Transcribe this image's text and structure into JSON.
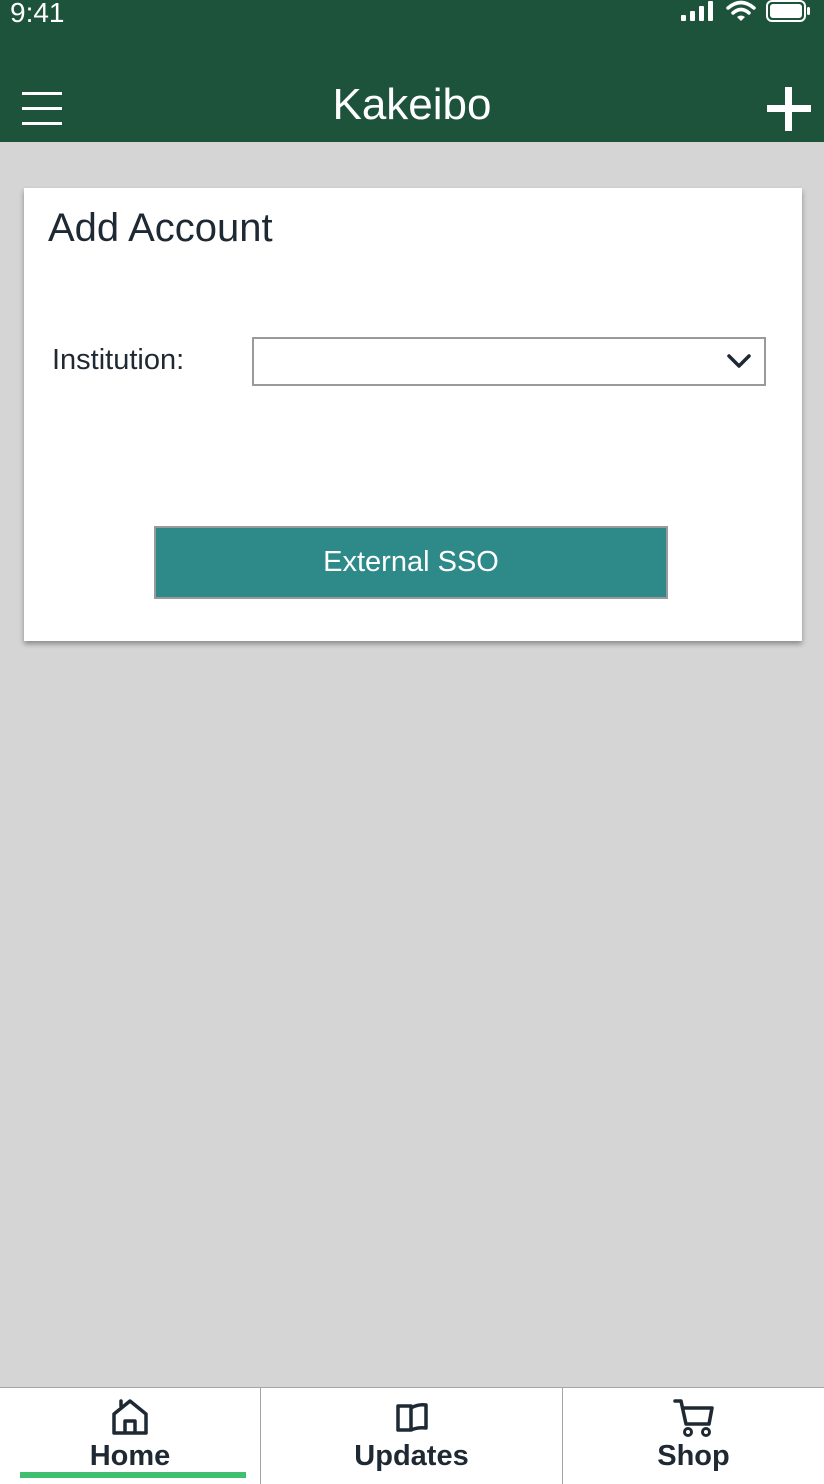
{
  "status_bar": {
    "time": "9:41",
    "icons": [
      "signal-icon",
      "wifi-icon",
      "battery-icon"
    ]
  },
  "header": {
    "title": "Kakeibo",
    "menu_icon": "hamburger-menu-icon",
    "add_icon": "plus-icon",
    "background_color": "#1d533b"
  },
  "card": {
    "title": "Add Account",
    "institution_label": "Institution:",
    "institution_value": "",
    "sso_button_label": "External SSO",
    "button_color": "#2e8989"
  },
  "tabs": [
    {
      "label": "Home",
      "icon": "home-icon",
      "active": true
    },
    {
      "label": "Updates",
      "icon": "book-icon",
      "active": false
    },
    {
      "label": "Shop",
      "icon": "cart-icon",
      "active": false
    }
  ],
  "colors": {
    "background": "#d5d5d5",
    "active_indicator": "#3fbf6f"
  }
}
